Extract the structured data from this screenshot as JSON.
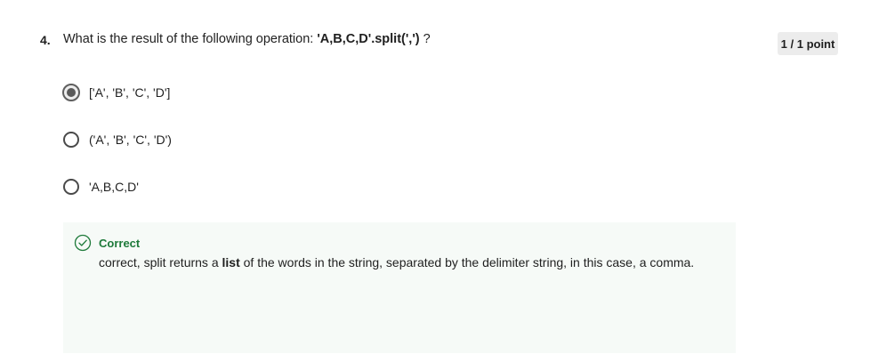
{
  "question": {
    "number": "4.",
    "text_prefix": "What is the result of the following operation: ",
    "code": "'A,B,C,D'.split(',')",
    "text_suffix": " ?"
  },
  "points": "1 / 1 point",
  "options": [
    {
      "label": "['A', 'B', 'C', 'D']",
      "selected": true
    },
    {
      "label": "('A', 'B', 'C', 'D')",
      "selected": false
    },
    {
      "label": "'A,B,C,D'",
      "selected": false
    }
  ],
  "feedback": {
    "status": "Correct",
    "text_before": "correct, split returns a ",
    "text_bold": "list",
    "text_after": " of the words in the string, separated by the delimiter string, in this case, a comma.",
    "accent_color": "#1e7a3a"
  }
}
